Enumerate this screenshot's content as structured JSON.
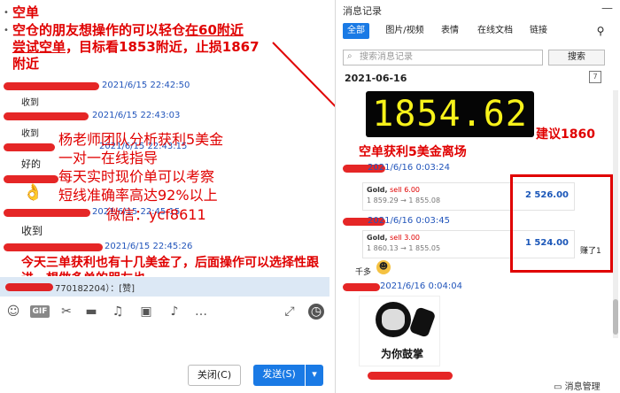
{
  "left_chat": {
    "post_title": "空单",
    "post_body_1": "空仓的朋友想操作的可以轻仓",
    "post_body_2": "在60附近",
    "post_body_3": "尝试空单",
    "post_body_4": "，目标看1853附近，止损1867",
    "post_body_5": "附近",
    "messages": [
      {
        "time": "2021/6/15 22:42:50",
        "text": "收到"
      },
      {
        "time": "2021/6/15 22:43:03",
        "text": "收到"
      },
      {
        "time": "2021/6/15 22:43:15",
        "text": "好的"
      },
      {
        "time": "2021/6/15 22:45:15",
        "text": "👌"
      },
      {
        "time": "2021/6/15 22:45:26",
        "text": "收到"
      }
    ],
    "last_message": "今天三单获利也有十几美金了，后面操作可以选择性跟进，想做多单的朋友也",
    "quote_text": "770182204）：[赞]"
  },
  "overlay_ad": {
    "line1": "杨老师团队分析获利5美金",
    "line2": "一对一在线指导",
    "line3": "每天实时现价单可以考察",
    "line4": "短线准确率高达92%以上",
    "line5": "微信：ycf8611"
  },
  "toolbar": {
    "gif_label": "GIF"
  },
  "buttons": {
    "close_label": "关闭(C)",
    "send_label": "发送(S)",
    "send_arrow": "▾"
  },
  "record_panel": {
    "title": "消息记录",
    "close": "—",
    "tabs": [
      "全部",
      "图片/视频",
      "表情",
      "在线文档",
      "链接"
    ],
    "search_placeholder": "搜索消息记录",
    "search_button": "搜索",
    "date": "2021-06-16",
    "price": "1854.62",
    "suggest": "建议1860",
    "headline": "空单获利5美金离场",
    "entries": [
      {
        "time": "2021/6/16 0:03:24"
      },
      {
        "time": "2021/6/16 0:03:45"
      },
      {
        "time": "2021/6/16 0:04:04"
      }
    ],
    "trades": [
      {
        "sym": "Gold,",
        "side": "sell 6.00",
        "route": "1 859.29 → 1 855.08",
        "amount": "2 526.00"
      },
      {
        "sym": "Gold,",
        "side": "sell 3.00",
        "route": "1 860.13 → 1 855.05",
        "amount": "1 524.00"
      }
    ],
    "earned": "赚了1",
    "qianduo": "千多",
    "sticker_caption": "为你鼓掌",
    "manage": "消息管理"
  },
  "colors": {
    "accent": "#1a7ae5",
    "alert_red": "#e00000",
    "price_yellow": "#f7f21a"
  }
}
